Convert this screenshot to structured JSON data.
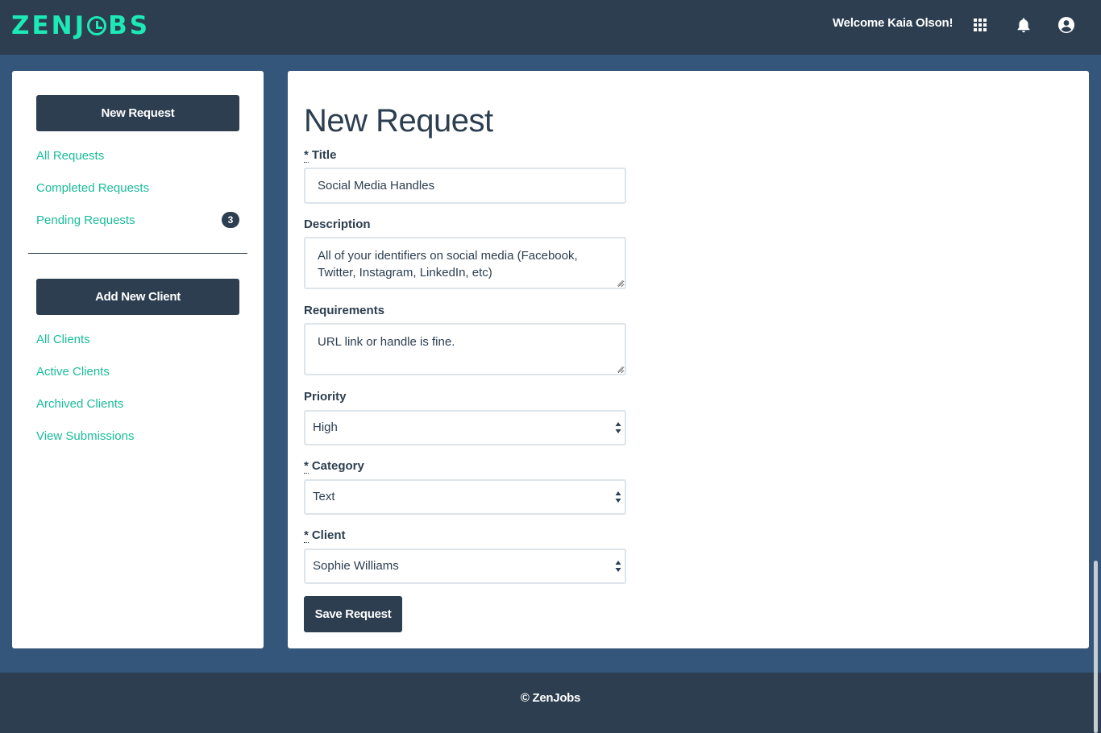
{
  "header": {
    "logo": "ZENJOBS",
    "welcome": "Welcome Kaia Olson!",
    "icons": [
      "apps-icon",
      "bell-icon",
      "account-icon"
    ]
  },
  "sidebar": {
    "new_request_button": "New Request",
    "request_links": [
      {
        "label": "All Requests"
      },
      {
        "label": "Completed Requests"
      },
      {
        "label": "Pending Requests",
        "badge": "3"
      }
    ],
    "add_client_button": "Add New Client",
    "client_links": [
      {
        "label": "All Clients"
      },
      {
        "label": "Active Clients"
      },
      {
        "label": "Archived Clients"
      },
      {
        "label": "View Submissions"
      }
    ]
  },
  "form": {
    "page_title": "New Request",
    "required_marker": "*",
    "title": {
      "label": "Title",
      "value": "Social Media Handles"
    },
    "description": {
      "label": "Description",
      "value": "All of your identifiers on social media (Facebook, Twitter, Instagram, LinkedIn, etc)"
    },
    "requirements": {
      "label": "Requirements",
      "value": "URL link or handle is fine."
    },
    "priority": {
      "label": "Priority",
      "value": "High"
    },
    "category": {
      "label": "Category",
      "value": "Text"
    },
    "client": {
      "label": "Client",
      "value": "Sophie Williams"
    },
    "save_button": "Save Request"
  },
  "footer": {
    "copyright": "© ZenJobs"
  },
  "colors": {
    "navy": "#2c3e50",
    "background": "#33567a",
    "accent": "#1abc9c",
    "logo": "#1de9b6"
  }
}
